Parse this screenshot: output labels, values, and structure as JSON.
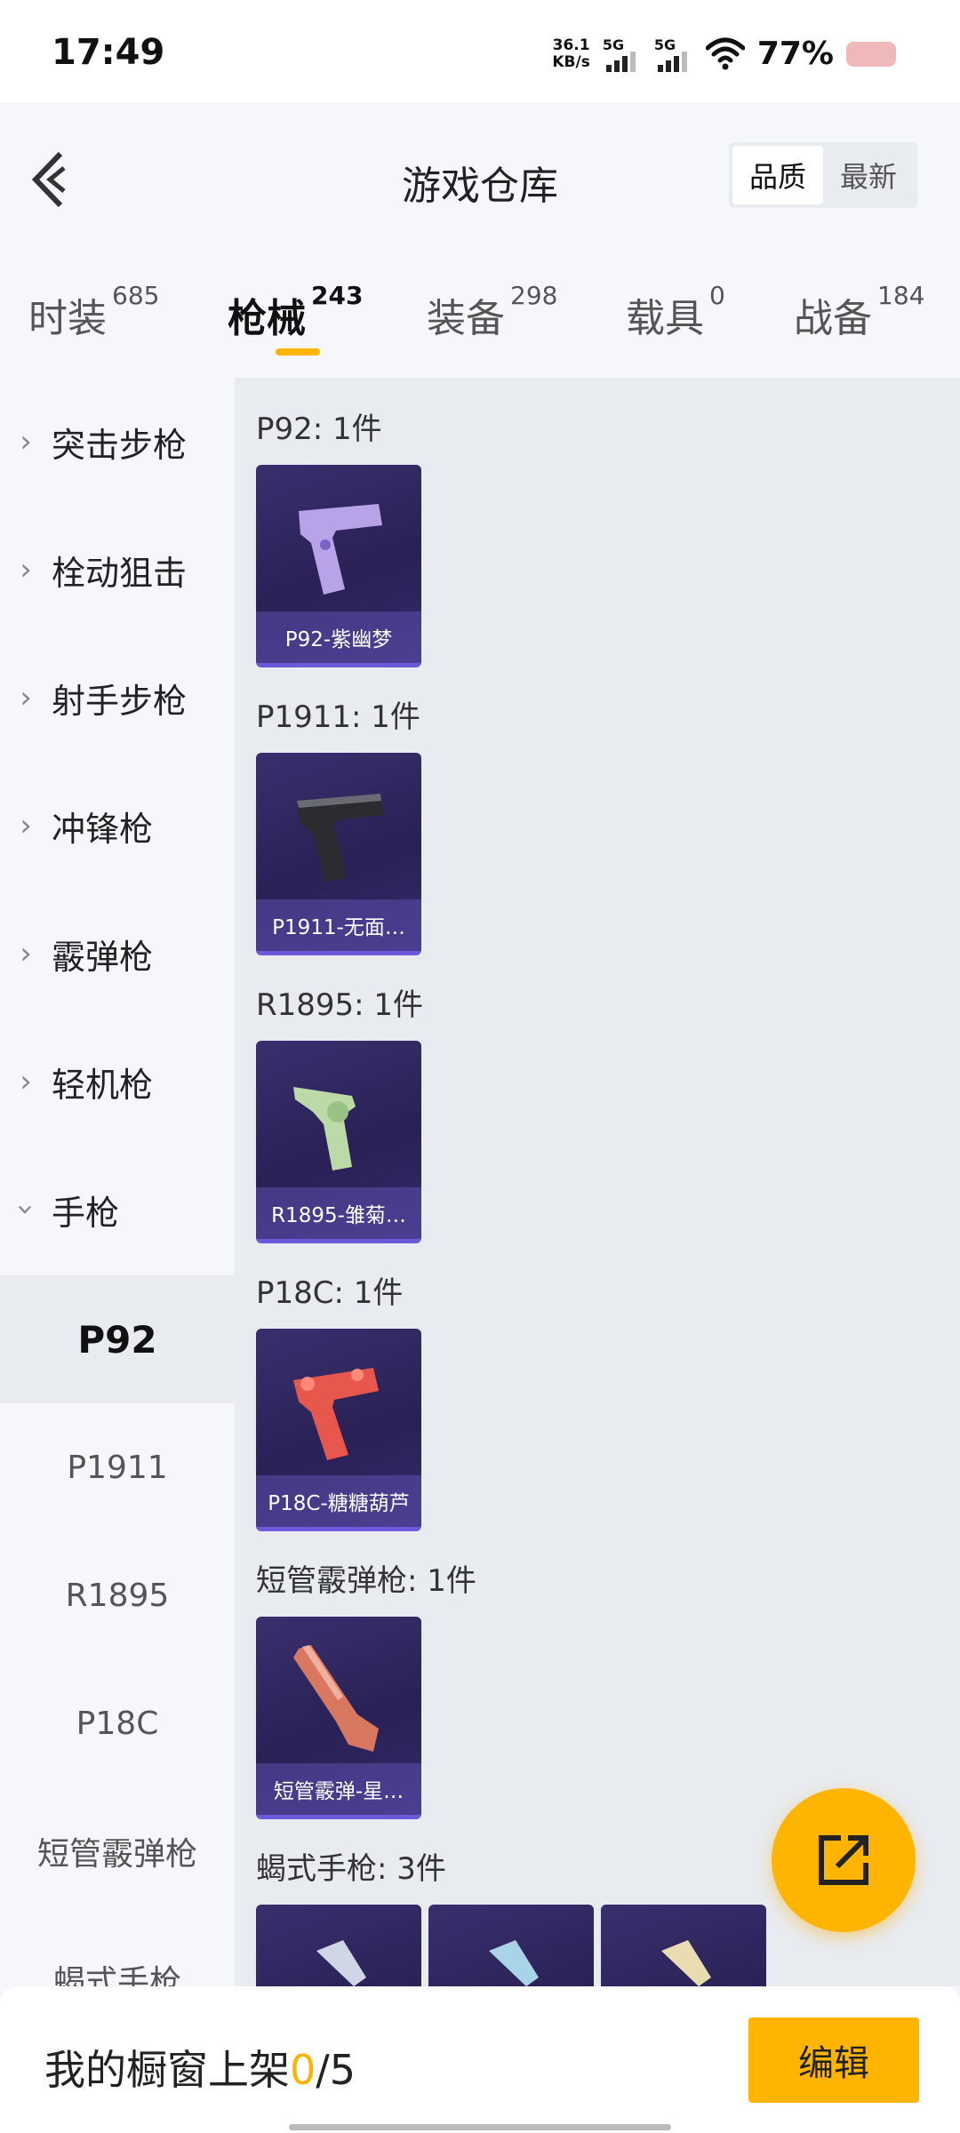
{
  "status_bar": {
    "time": "17:49",
    "speed_value": "36.1",
    "speed_unit": "KB/s",
    "sim1": "5G",
    "sim2": "5G",
    "battery": "77%"
  },
  "header": {
    "title": "游戏仓库",
    "sort_options": [
      "品质",
      "最新"
    ],
    "active_sort": "品质"
  },
  "tabs": [
    {
      "label": "时装",
      "count": "685"
    },
    {
      "label": "枪械",
      "count": "243"
    },
    {
      "label": "装备",
      "count": "298"
    },
    {
      "label": "载具",
      "count": "0"
    },
    {
      "label": "战备",
      "count": "184"
    }
  ],
  "active_tab": "枪械",
  "sidebar": {
    "categories": [
      "突击步枪",
      "栓动狙击",
      "射手步枪",
      "冲锋枪",
      "霰弹枪",
      "轻机枪",
      "手枪"
    ],
    "expanded": "手枪",
    "subitems": [
      "P92",
      "P1911",
      "R1895",
      "P18C",
      "短管霰弹枪",
      "蝎式手枪"
    ],
    "active_subitem": "P92"
  },
  "groups": [
    {
      "title": "P92: 1件",
      "items": [
        "P92-紫幽梦"
      ],
      "gun_color": "#b9a3e8"
    },
    {
      "title": "P1911: 1件",
      "items": [
        "P1911-无面…"
      ],
      "gun_color": "#2b2b30"
    },
    {
      "title": "R1895: 1件",
      "items": [
        "R1895-雏菊…"
      ],
      "gun_color": "#bcd9a8"
    },
    {
      "title": "P18C: 1件",
      "items": [
        "P18C-糖糖葫芦"
      ],
      "gun_color": "#e8574e"
    },
    {
      "title": "短管霰弹枪: 1件",
      "items": [
        "短管霰弹-星…"
      ],
      "gun_color": "#d87860"
    },
    {
      "title": "蝎式手枪: 3件",
      "items": [
        "",
        "",
        ""
      ],
      "gun_color": "#cfd6e6"
    }
  ],
  "bottom_bar": {
    "text_prefix": "我的橱窗上架",
    "shown": "0",
    "total": "/5",
    "edit_label": "编辑"
  }
}
